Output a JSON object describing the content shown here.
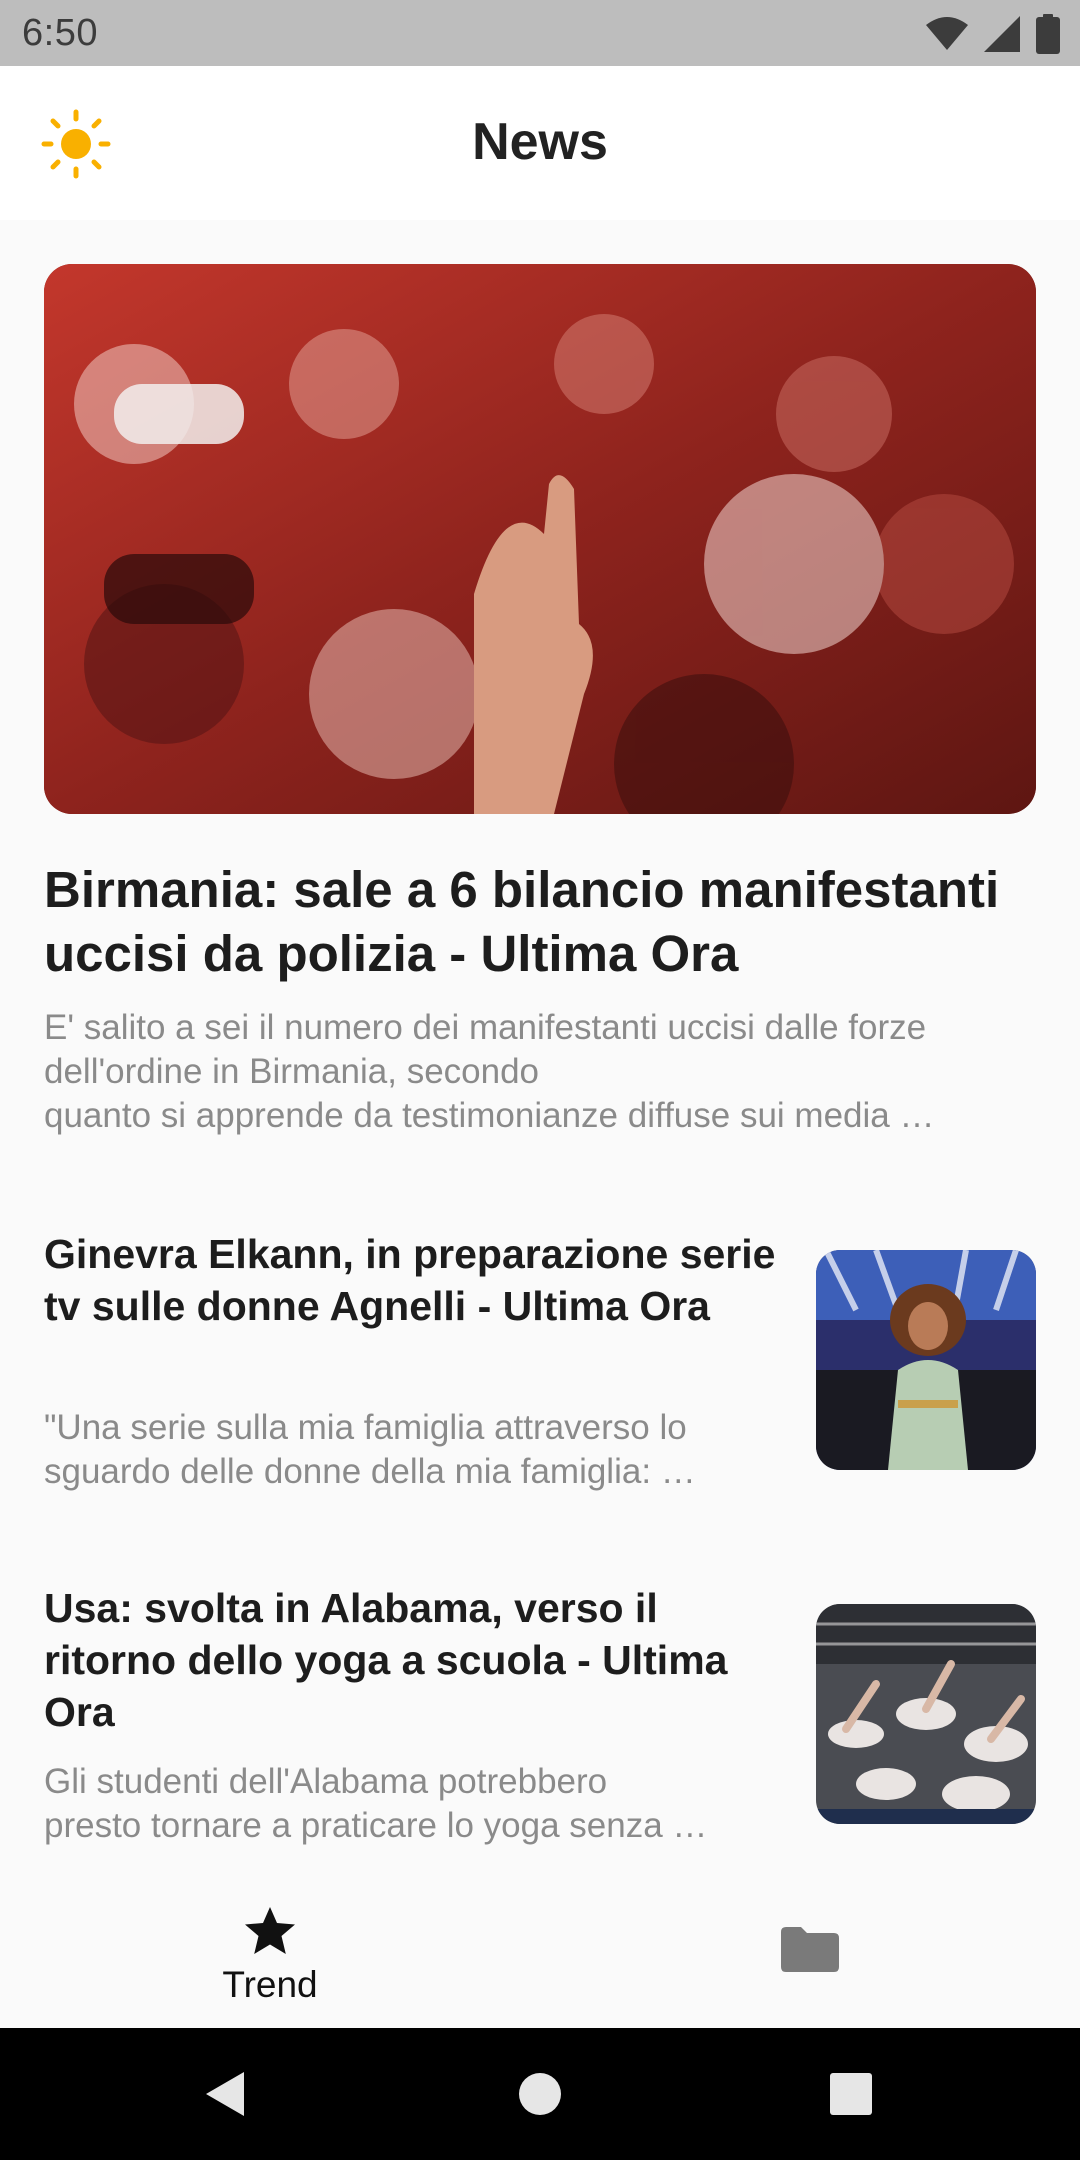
{
  "status_bar": {
    "time": "6:50",
    "icons": [
      "wifi-icon",
      "signal-icon",
      "battery-icon"
    ]
  },
  "app_bar": {
    "title": "News",
    "theme_icon": "sun-icon",
    "accent_color": "#f9b000"
  },
  "articles": {
    "featured": {
      "title": "Birmania: sale a 6 bilancio manifestanti uccisi da polizia - Ultima Ora",
      "description_lines": [
        "E' salito a sei il numero dei manifestanti uccisi dalle forze",
        "dell'ordine in Birmania, secondo",
        "quanto si apprende da testimonianze diffuse sui media …"
      ]
    },
    "list": [
      {
        "title": "Ginevra Elkann, in preparazione serie tv sulle donne Agnelli - Ultima Ora",
        "description_lines": [
          "\"Una serie sulla mia famiglia attraverso lo",
          "sguardo delle donne della mia famiglia: …"
        ]
      },
      {
        "title": "Usa: svolta in Alabama, verso il ritorno dello yoga a scuola - Ultima Ora",
        "description_lines": [
          "Gli studenti dell'Alabama potrebbero",
          "presto tornare a praticare lo yoga senza …"
        ]
      }
    ]
  },
  "bottom_nav": {
    "items": [
      {
        "label": "Trend",
        "icon": "star-icon",
        "selected": true
      },
      {
        "label": "",
        "icon": "folder-icon",
        "selected": false
      }
    ]
  },
  "system_nav": {
    "buttons": [
      "back-icon",
      "home-icon",
      "recents-icon"
    ]
  }
}
